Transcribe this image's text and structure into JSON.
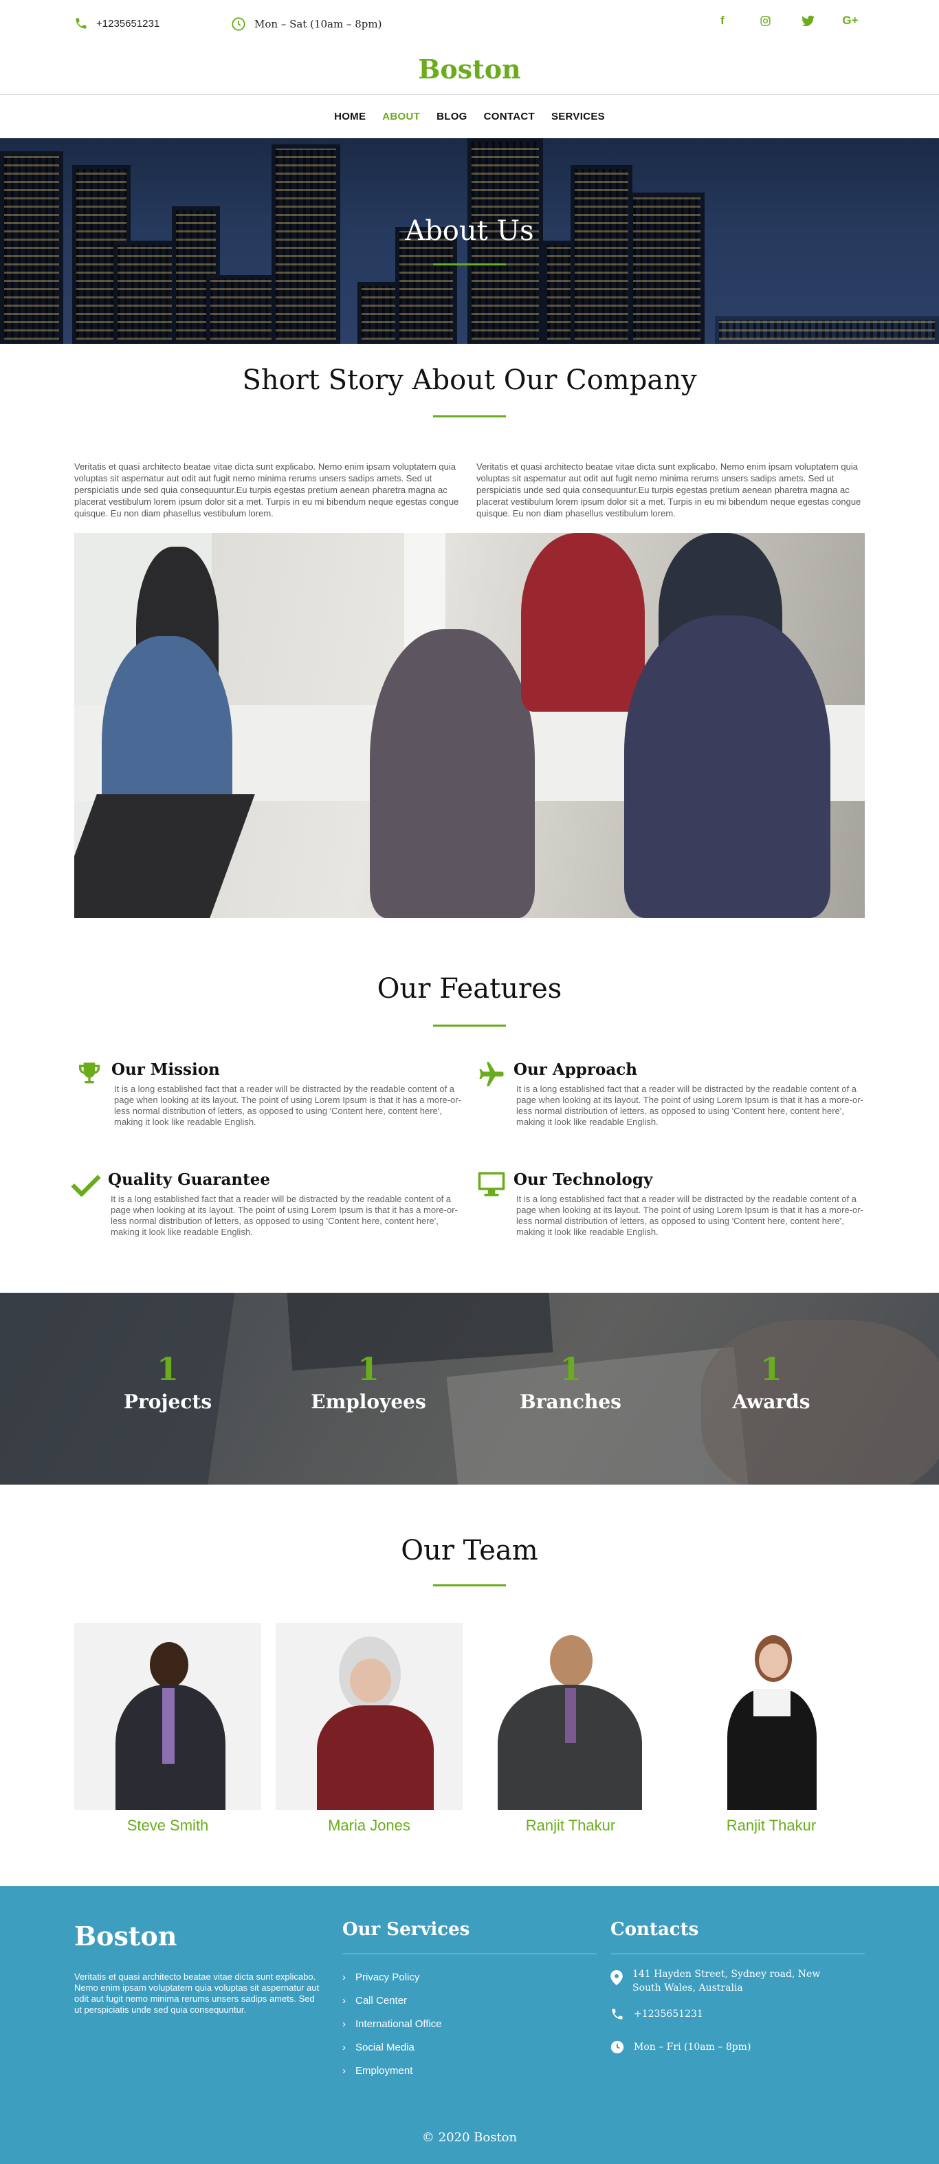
{
  "topbar": {
    "phone": "+1235651231",
    "hours": "Mon – Sat (10am – 8pm)",
    "social_icons": [
      "facebook-icon",
      "instagram-icon",
      "twitter-icon",
      "google-plus-icon"
    ]
  },
  "brand": "Boston",
  "nav": {
    "items": [
      {
        "label": "HOME",
        "active": false
      },
      {
        "label": "ABOUT",
        "active": true
      },
      {
        "label": "BLOG",
        "active": false
      },
      {
        "label": "CONTACT",
        "active": false
      },
      {
        "label": "SERVICES",
        "active": false
      }
    ]
  },
  "hero": {
    "title": "About Us"
  },
  "story": {
    "title": "Short Story About Our Company",
    "col1": "Veritatis et quasi architecto beatae vitae dicta sunt explicabo. Nemo enim ipsam voluptatem quia voluptas sit aspernatur aut odit aut fugit nemo minima rerums unsers sadips amets. Sed ut perspiciatis unde sed quia consequuntur.Eu turpis egestas pretium aenean pharetra magna ac placerat vestibulum lorem ipsum dolor sit a met. Turpis in eu mi bibendum neque egestas congue quisque. Eu non diam phasellus vestibulum lorem.",
    "col2": "Veritatis et quasi architecto beatae vitae dicta sunt explicabo. Nemo enim ipsam voluptatem quia voluptas sit aspernatur aut odit aut fugit nemo minima rerums unsers sadips amets. Sed ut perspiciatis unde sed quia consequuntur.Eu turpis egestas pretium aenean pharetra magna ac placerat vestibulum lorem ipsum dolor sit a met. Turpis in eu mi bibendum neque egestas congue quisque. Eu non diam phasellus vestibulum lorem."
  },
  "features": {
    "title": "Our Features",
    "items": [
      {
        "title": "Our Mission",
        "icon": "trophy-icon",
        "text": "It is a long established fact that a reader will be distracted by the readable content of a page when looking at its layout. The point of using Lorem Ipsum is that it has a more-or-less normal distribution of letters, as opposed to using 'Content here, content here', making it look like readable English."
      },
      {
        "title": "Our Approach",
        "icon": "plane-icon",
        "text": "It is a long established fact that a reader will be distracted by the readable content of a page when looking at its layout. The point of using Lorem Ipsum is that it has a more-or-less normal distribution of letters, as opposed to using 'Content here, content here', making it look like readable English."
      },
      {
        "title": "Quality Guarantee",
        "icon": "checkmark-icon",
        "text": "It is a long established fact that a reader will be distracted by the readable content of a page when looking at its layout. The point of using Lorem Ipsum is that it has a more-or-less normal distribution of letters, as opposed to using 'Content here, content here', making it look like readable English."
      },
      {
        "title": "Our Technology",
        "icon": "monitor-icon",
        "text": "It is a long established fact that a reader will be distracted by the readable content of a page when looking at its layout. The point of using Lorem Ipsum is that it has a more-or-less normal distribution of letters, as opposed to using 'Content here, content here', making it look like readable English."
      }
    ]
  },
  "stats": [
    {
      "num": "1",
      "label": "Projects"
    },
    {
      "num": "1",
      "label": "Employees"
    },
    {
      "num": "1",
      "label": "Branches"
    },
    {
      "num": "1",
      "label": "Awards"
    }
  ],
  "team": {
    "title": "Our Team",
    "members": [
      {
        "name": "Steve Smith"
      },
      {
        "name": "Maria Jones"
      },
      {
        "name": "Ranjit Thakur"
      },
      {
        "name": "Ranjit Thakur"
      }
    ]
  },
  "footer": {
    "brand": "Boston",
    "about": "Veritatis et quasi architecto beatae vitae dicta sunt explicabo. Nemo enim ipsam voluptatem quia voluptas sit aspernatur aut odit aut fugit nemo minima rerums unsers sadips amets. Sed ut perspiciatis unde sed quia consequuntur.",
    "services_title": "Our Services",
    "services": [
      "Privacy Policy",
      "Call Center",
      "International Office",
      "Social Media",
      "Employment"
    ],
    "contacts_title": "Contacts",
    "address": "141 Hayden Street, Sydney road, New South Wales, Australia",
    "phone": "+1235651231",
    "hours": "Mon – Fri (10am – 8pm)",
    "copyright": "© 2020 Boston"
  },
  "colors": {
    "accent": "#6aac1c",
    "footer": "#3d9ec0"
  }
}
